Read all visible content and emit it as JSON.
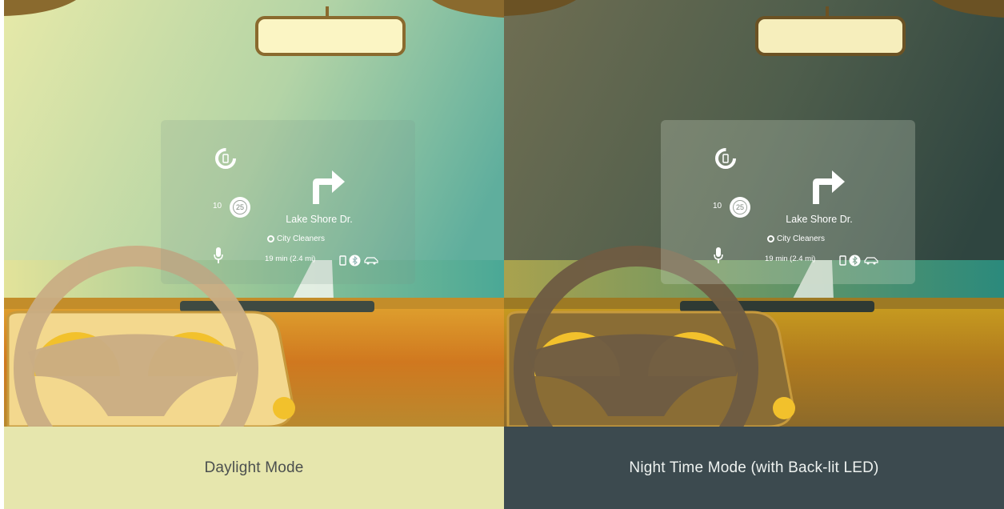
{
  "panels": [
    {
      "mode": "day",
      "caption": "Daylight Mode",
      "hud": {
        "street": "Lake Shore Dr.",
        "destination": "City Cleaners",
        "eta": "19 min (2.4 mi)",
        "current_speed": "10",
        "speed_limit": "25"
      }
    },
    {
      "mode": "night",
      "caption": "Night Time Mode (with Back-lit LED)",
      "hud": {
        "street": "Lake Shore Dr.",
        "destination": "City Cleaners",
        "eta": "19 min (2.4 mi)",
        "current_speed": "10",
        "speed_limit": "25"
      }
    }
  ],
  "colors": {
    "day_caption_bg": "#e6e6ad",
    "night_caption_bg": "#3c4a4f",
    "hud_text": "#ffffff",
    "dash_orange": "#d88a24",
    "gauge_yellow": "#f2c12c"
  },
  "icons": [
    "fuel-gauge-icon",
    "turn-right-arrow-icon",
    "microphone-icon",
    "phone-icon",
    "bluetooth-icon",
    "car-icon",
    "location-pin-icon"
  ]
}
